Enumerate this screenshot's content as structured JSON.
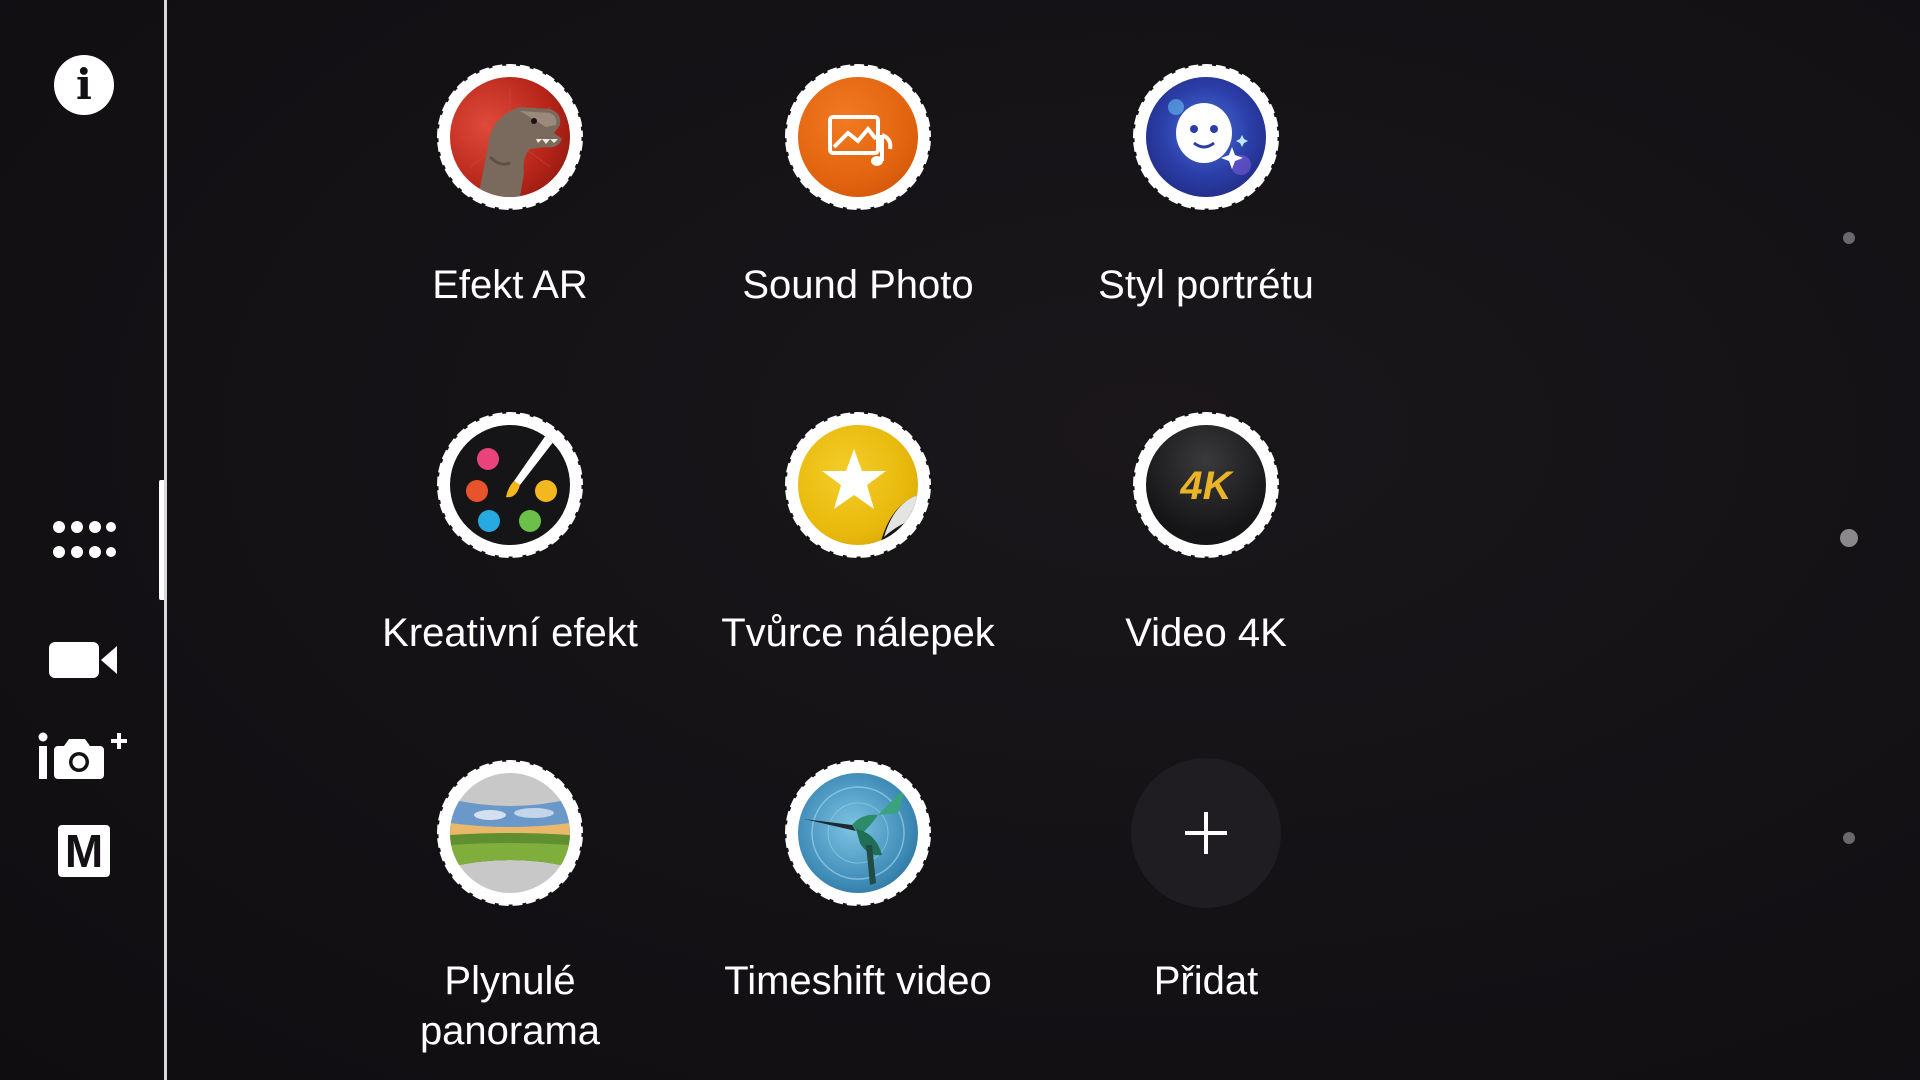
{
  "rail": {
    "info_label": "i",
    "manual_label": "M"
  },
  "modes": [
    {
      "label": "Efekt AR",
      "icon": "ar-effect-dinosaur-icon"
    },
    {
      "label": "Sound Photo",
      "icon": "sound-photo-icon"
    },
    {
      "label": "Styl portrétu",
      "icon": "portrait-style-icon"
    },
    {
      "label": "Kreativní efekt",
      "icon": "creative-effect-palette-icon"
    },
    {
      "label": "Tvůrce nálepek",
      "icon": "sticker-creator-icon"
    },
    {
      "label": "Video 4K",
      "icon": "video-4k-icon",
      "badge": "4K"
    },
    {
      "label": "Plynulé\npanorama",
      "icon": "sweep-panorama-icon"
    },
    {
      "label": "Timeshift video",
      "icon": "timeshift-video-hummingbird-icon"
    },
    {
      "label": "Přidat",
      "icon": "add-plus-icon"
    }
  ],
  "colors": {
    "background": "#131114",
    "sound_photo_orange": "#e2630f",
    "sticker_yellow": "#e8b90c",
    "gold_4k": "#e9b526"
  }
}
